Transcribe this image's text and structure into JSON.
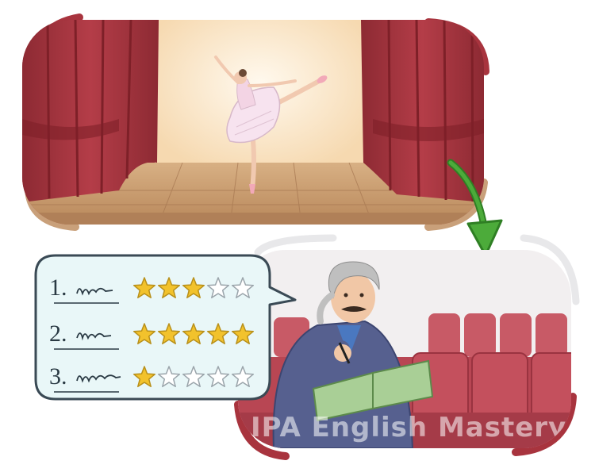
{
  "watermark": "IPA English Mastery",
  "ratings": [
    {
      "number": "1.",
      "stars_filled": 3,
      "stars_total": 5
    },
    {
      "number": "2.",
      "stars_filled": 5,
      "stars_total": 5
    },
    {
      "number": "3.",
      "stars_filled": 1,
      "stars_total": 5
    }
  ],
  "colors": {
    "curtain": "#a8343e",
    "curtain_dark": "#7e2028",
    "stage_floor": "#c79a6a",
    "spotlight": "#fbe6c7",
    "arrow": "#3b9a2c",
    "star_filled": "#f2c22c",
    "star_empty": "#ffffff",
    "bubble_fill": "#e9f7f8",
    "bubble_stroke": "#3a4a55",
    "seat": "#b84653",
    "jacket": "#4f5a86",
    "folder": "#a9cf96"
  },
  "icons": [
    "stage-scene",
    "ballerina",
    "down-arrow-icon",
    "speech-bubble",
    "star-icon",
    "critic",
    "theatre-seats"
  ]
}
